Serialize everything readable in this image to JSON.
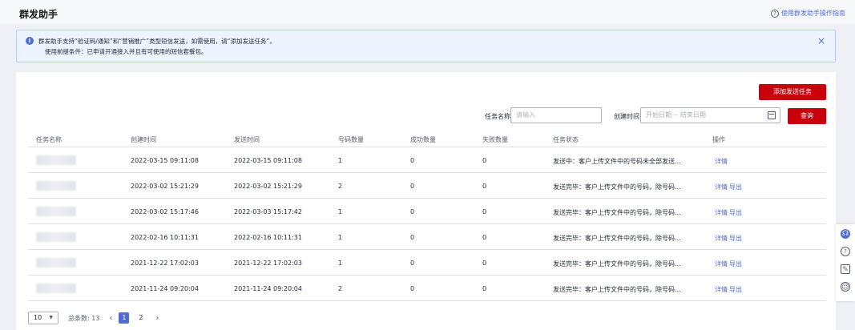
{
  "header": {
    "title": "群发助手",
    "guide_label": "使用群发助手操作指南",
    "guide_icon": "question-circle-icon"
  },
  "notice": {
    "icon": "info-icon",
    "line1": "群发助手支持“验证码/通知”和“营销推广”类型短信发送，如需使用，请“添加发送任务”。",
    "line2": "使用前提条件：已申请开通接入并且有可使用的短信套餐包。",
    "close_icon": "×"
  },
  "toolbar": {
    "add_label": "添加发送任务",
    "task_name_label": "任务名称",
    "task_name_placeholder": "请输入",
    "create_time_label": "创建时间",
    "date_placeholder": "开始日期 -- 结束日期",
    "query_label": "查询"
  },
  "table": {
    "columns": [
      "任务名称",
      "创建时间",
      "发送时间",
      "号码数量",
      "成功数量",
      "失败数量",
      "任务状态",
      "操作"
    ],
    "rows": [
      {
        "created": "2022-03-15 09:11:08",
        "sent": "2022-03-15 09:11:08",
        "count": "1",
        "success": "0",
        "fail": "0",
        "status": "发送中：客户上传文件中的号码未全部发送...",
        "detail": "详情",
        "export": ""
      },
      {
        "created": "2022-03-02 15:21:29",
        "sent": "2022-03-02 15:21:29",
        "count": "2",
        "success": "0",
        "fail": "0",
        "status": "发送完毕：客户上传文件中的号码，除号码...",
        "detail": "详情",
        "export": "导出"
      },
      {
        "created": "2022-03-02 15:17:46",
        "sent": "2022-03-03 15:17:42",
        "count": "1",
        "success": "0",
        "fail": "0",
        "status": "发送完毕：客户上传文件中的号码，除号码...",
        "detail": "详情",
        "export": "导出"
      },
      {
        "created": "2022-02-16 10:11:31",
        "sent": "2022-02-16 10:11:31",
        "count": "1",
        "success": "0",
        "fail": "0",
        "status": "发送完毕：客户上传文件中的号码，除号码...",
        "detail": "详情",
        "export": "导出"
      },
      {
        "created": "2021-12-22 17:02:03",
        "sent": "2021-12-22 17:02:03",
        "count": "1",
        "success": "0",
        "fail": "0",
        "status": "发送完毕：客户上传文件中的号码，除号码...",
        "detail": "详情",
        "export": "导出"
      },
      {
        "created": "2021-11-24 09:20:04",
        "sent": "2021-11-24 09:20:04",
        "count": "2",
        "success": "0",
        "fail": "0",
        "status": "发送完毕：客户上传文件中的号码，除号码...",
        "detail": "详情",
        "export": "导出"
      }
    ]
  },
  "pager": {
    "page_size": "10",
    "total_label": "总条数: 13",
    "prev": "‹",
    "pages": [
      "1",
      "2"
    ],
    "active_page": "1",
    "next": "›"
  },
  "float_bar": {
    "icons": [
      "headset-icon",
      "help-icon",
      "feedback-note-icon",
      "smile-icon"
    ]
  },
  "colors": {
    "brand_red": "#c7000b",
    "link_blue": "#526ecc",
    "notice_bg": "#edf3ff"
  }
}
